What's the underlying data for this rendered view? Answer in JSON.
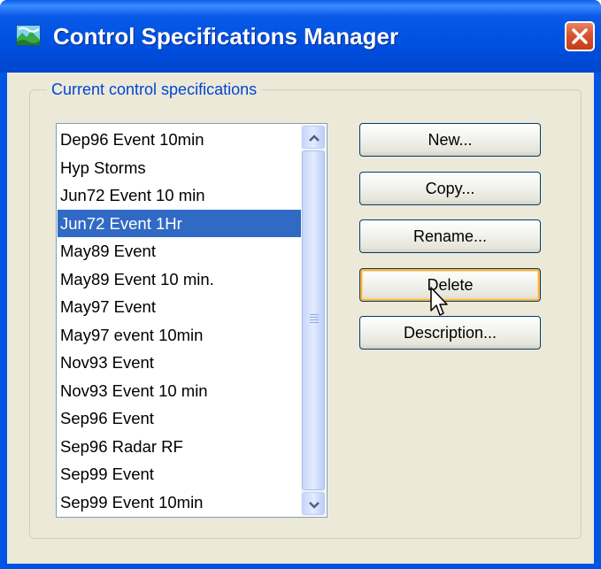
{
  "window": {
    "title": "Control Specifications Manager"
  },
  "group": {
    "label": "Current control specifications"
  },
  "list": {
    "items": [
      "Dep96 Event 10min",
      "Hyp Storms",
      "Jun72 Event 10 min",
      "Jun72 Event 1Hr",
      "May89 Event",
      "May89 Event 10 min.",
      "May97 Event",
      "May97 event 10min",
      "Nov93 Event",
      "Nov93 Event 10 min",
      "Sep96 Event",
      "Sep96 Radar RF",
      "Sep99 Event",
      "Sep99 Event 10min"
    ],
    "selected": "Jun72 Event 1Hr"
  },
  "buttons": {
    "new": "New...",
    "copy": "Copy...",
    "rename": "Rename...",
    "delete": "Delete",
    "description": "Description..."
  },
  "colors": {
    "titlebar": "#0054e3",
    "selection": "#316ac5",
    "dialog_bg": "#ece9d8",
    "group_label": "#0046d5",
    "close_button": "#d9532c"
  },
  "icons": {
    "app": "landscape-map-icon",
    "close": "close-icon",
    "scroll_up": "chevron-up-icon",
    "scroll_down": "chevron-down-icon",
    "cursor": "mouse-pointer-icon"
  }
}
